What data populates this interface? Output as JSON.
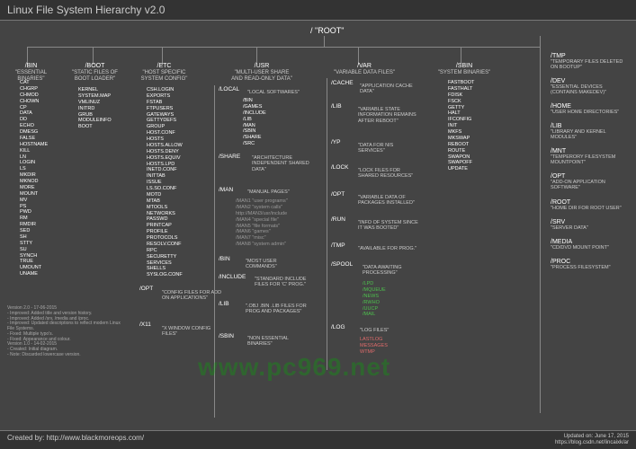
{
  "header": {
    "title": "Linux File System Hierarchy v2.0"
  },
  "footer": {
    "created_by": "Created by: http://www.blackmoreops.com/",
    "updated": "Updated on: June 17, 2015",
    "link2": "https://blog.csdn.net/lincaixk/ar"
  },
  "root": {
    "path": "/",
    "label": "\"ROOT\""
  },
  "notes": [
    "Version 2.0 - 17-06-2015",
    "- Improved: Added title and version history.",
    "- Improved: Added /srv, /media and /proc.",
    "- Improved: Updated descriptions to reflect modern Linux File Systems.",
    "- Fixed: Multiple typo's.",
    "- Fixed: Appearance and colour.",
    "Version 1.0 - 14-02-2015",
    "- Created: Initial diagram.",
    "- Note: Discarded lowercase version."
  ],
  "watermark": "www.pc969.net",
  "columns": {
    "bin": {
      "path": "/BIN",
      "desc": "\"ESSENTIAL BINARIES\"",
      "items": [
        "CAT",
        "CHGRP",
        "CHMOD",
        "CHOWN",
        "CP",
        "DATA",
        "DD",
        "ECHO",
        "DMESG",
        "FALSE",
        "HOSTNAME",
        "KILL",
        "LN",
        "LOGIN",
        "LS",
        "MKDIR",
        "MKNOD",
        "MORE",
        "MOUNT",
        "MV",
        "PS",
        "PWD",
        "RM",
        "RMDIR",
        "SED",
        "SH",
        "STTY",
        "SU",
        "SYNCH",
        "TRUE",
        "UMOUNT",
        "UNAME"
      ]
    },
    "boot": {
      "path": "/BOOT",
      "desc": "\"STATIC FILES OF BOOT LOADER\"",
      "items": [
        "KERNEL",
        "SYSTEM.MAP",
        "VMLINUZ",
        "INITRD",
        "GRUB",
        "MODULEINFO",
        "BOOT"
      ]
    },
    "etc": {
      "path": "/ETC",
      "desc": "\"HOST SPECIFIC SYSTEM CONFIG\"",
      "items": [
        "CSH.LOGIN",
        "EXPORTS",
        "FSTAB",
        "FTPUSERS",
        "GATEWAYS",
        "GETTYDEFS",
        "GROUP",
        "HOST.CONF",
        "HOSTS",
        "HOSTS.ALLOW",
        "HOSTS.DENY",
        "HOSTS.EQUIV",
        "HOSTS.LPD",
        "INETD.CONF",
        "INITTAB",
        "ISSUE",
        "LS.SO.CONF",
        "MOTD",
        "MTAB",
        "MTOOLS",
        "NETWORKS",
        "PASSWD",
        "PRINTCAP",
        "PROFILE",
        "PROTOCOLS",
        "RESOLV.CONF",
        "RPC",
        "SECURETTY",
        "SERVICES",
        "SHELLS",
        "SYSLOG.CONF"
      ],
      "subs": [
        {
          "path": "/OPT",
          "desc": "\"CONFIG FILES FOR ADD ON APPLICATIONS\""
        },
        {
          "path": "/X11",
          "desc": "\"X WINDOW CONFIG FILES\""
        }
      ]
    },
    "usr": {
      "path": "/USR",
      "desc": "\"MULTI-USER SHARE AND READ-ONLY DATA\"",
      "subs": [
        {
          "path": "/LOCAL",
          "desc": "\"LOCAL SOFTWARES\"",
          "items": [
            "/BIN",
            "/GAMES",
            "/INCLUDE",
            "/LIB",
            "/MAN",
            "/SBIN",
            "/SHARE",
            "/SRC"
          ]
        },
        {
          "path": "/SHARE",
          "desc": "\"ARCHITECTURE INDEPENDENT SHARED DATA\""
        },
        {
          "path": "/MAN",
          "desc": "\"MANUAL PAGES\"",
          "items": [
            "/MAN1 \"user programs\"",
            "/MAN2 \"system calls\"",
            "http://MAN3/usr/include",
            "/MAN4 \"special file\"",
            "/MAN5 \"file formats\"",
            "/MAN6 \"games\"",
            "/MAN7 \"misc\"",
            "/MAN8 \"system admin\""
          ]
        },
        {
          "path": "/BIN",
          "desc": "\"MOST USER COMMANDS\""
        },
        {
          "path": "/INCLUDE",
          "desc": "\"STANDARD INCLUDE FILES FOR 'C' PROG.\""
        },
        {
          "path": "/LIB",
          "desc": "\".OBJ .BIN .LIB FILES FOR PROG AND PACKAGES\""
        },
        {
          "path": "/SBIN",
          "desc": "\"NON ESSENTIAL BINARIES\""
        }
      ]
    },
    "var": {
      "path": "/VAR",
      "desc": "\"VARIABLE DATA FILES\"",
      "subs": [
        {
          "path": "/CACHE",
          "desc": "\"APPLICATION CACHE DATA\""
        },
        {
          "path": "/LIB",
          "desc": "\"VARIABLE STATE INFORMATION REMAINS AFTER REBOOT\""
        },
        {
          "path": "/YP",
          "desc": "\"DATA FOR NIS SERVICES\""
        },
        {
          "path": "/LOCK",
          "desc": "\"LOCK FILES FOR SHARED RESOURCES\""
        },
        {
          "path": "/OPT",
          "desc": "\"VARIABLE DATA OF PACKAGES INSTALLED\""
        },
        {
          "path": "/RUN",
          "desc": "\"INFO OF SYSTEM SINCE IT WAS BOOTED\""
        },
        {
          "path": "/TMP",
          "desc": "\"AVAILABLE FOR PROG.\""
        },
        {
          "path": "/SPOOL",
          "desc": "\"DATA AWAITING PROCESSING\"",
          "green_items": [
            "/LPD",
            "/MQUEUE",
            "/NEWS",
            "/RWHO",
            "/UUCP",
            "/MAIL"
          ]
        },
        {
          "path": "/LOG",
          "desc": "\"LOG FILES\"",
          "red_items": [
            "LASTLOG",
            "MESSAGES",
            "WTMP"
          ]
        }
      ]
    },
    "sbin": {
      "path": "/SBIN",
      "desc": "\"SYSTEM BINARIES\"",
      "items": [
        "FASTBOOT",
        "FASTHALT",
        "FDISK",
        "FSCK",
        "GETTY",
        "HALT",
        "IFCONFIG",
        "INIT",
        "MKFS",
        "MKSWAP",
        "REBOOT",
        "ROUTE",
        "SWAPON",
        "SWAPOFF",
        "UPDATE"
      ]
    }
  },
  "right_rail": [
    {
      "path": "/TMP",
      "desc": "\"TEMPORARY FILES DELETED ON BOOTUP\""
    },
    {
      "path": "/DEV",
      "desc": "\"ESSENTIAL DEVICES (CONTAINS MAKEDEV)\""
    },
    {
      "path": "/HOME",
      "desc": "\"USER HOME DIRECTORIES\""
    },
    {
      "path": "/LIB",
      "desc": "\"LIBRARY AND KERNEL MODULES\""
    },
    {
      "path": "/MNT",
      "desc": "\"TEMPERORY FILESYSTEM MOUNTPOINT\""
    },
    {
      "path": "/OPT",
      "desc": "\"ADD-ON APPLICATION SOFTWARE\""
    },
    {
      "path": "/ROOT",
      "desc": "\"HOME DIR FOR ROOT USER\""
    },
    {
      "path": "/SRV",
      "desc": "\"SERVER DATA\""
    },
    {
      "path": "/MEDIA",
      "desc": "\"CD/DVD MOUNT POINT\""
    },
    {
      "path": "/PROC",
      "desc": "\"PROCESS FILESYSTEM\""
    }
  ]
}
